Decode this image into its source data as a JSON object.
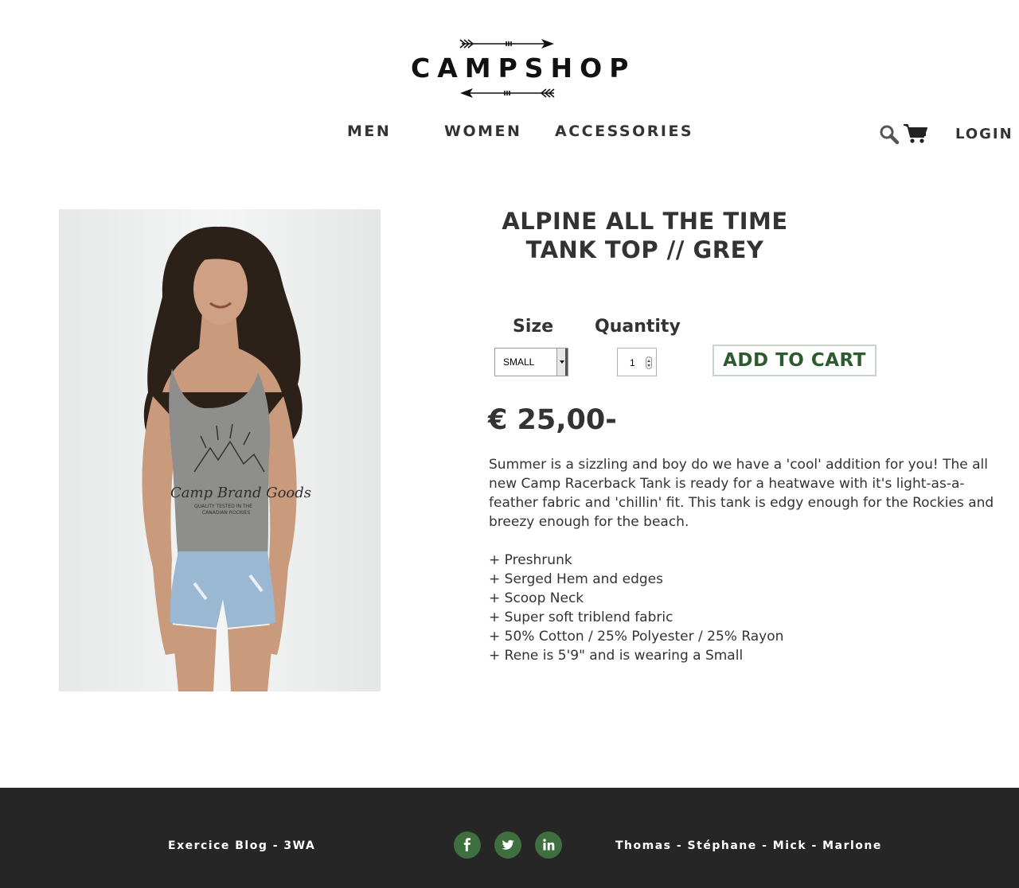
{
  "header": {
    "logo_text": "CAMPSHOP",
    "nav": [
      {
        "label": "MEN"
      },
      {
        "label": "WOMEN"
      },
      {
        "label": "ACCESSORIES"
      }
    ],
    "login_label": "LOGIN",
    "icons": [
      "search-icon",
      "cart-icon"
    ]
  },
  "product": {
    "title_line1": "ALPINE ALL THE TIME",
    "title_line2": "TANK TOP // GREY",
    "image": {
      "print_line1": "Camp Brand Goods",
      "print_line2": "QUALITY TESTED IN THE",
      "print_line3": "CANADIAN ROCKIES"
    },
    "size_label": "Size",
    "size_selected": "SMALL",
    "quantity_label": "Quantity",
    "quantity_value": "1",
    "add_to_cart_label": "ADD TO CART",
    "price": "€ 25,00-",
    "description": "Summer is a sizzling and boy do we have a 'cool' addition for you! The all new Camp Racerback Tank is ready for a heatwave with it's light-as-a-feather fabric and 'chillin' fit. This tank is edgy enough for the Rockies and breezy enough for the beach.",
    "features": [
      "+ Preshrunk",
      "+ Serged Hem and edges",
      "+ Scoop Neck",
      "+ Super soft triblend fabric",
      "+ 50% Cotton / 25% Polyester / 25% Rayon",
      "+ Rene is 5'9\" and is wearing a Small"
    ]
  },
  "footer": {
    "left_text": "Exercice Blog - 3WA",
    "right_text": "Thomas - Stéphane - Mick - Marlone",
    "social": [
      "facebook-icon",
      "twitter-icon",
      "linkedin-icon"
    ],
    "accent_color": "#3f6e3f",
    "background_color": "#262626"
  }
}
